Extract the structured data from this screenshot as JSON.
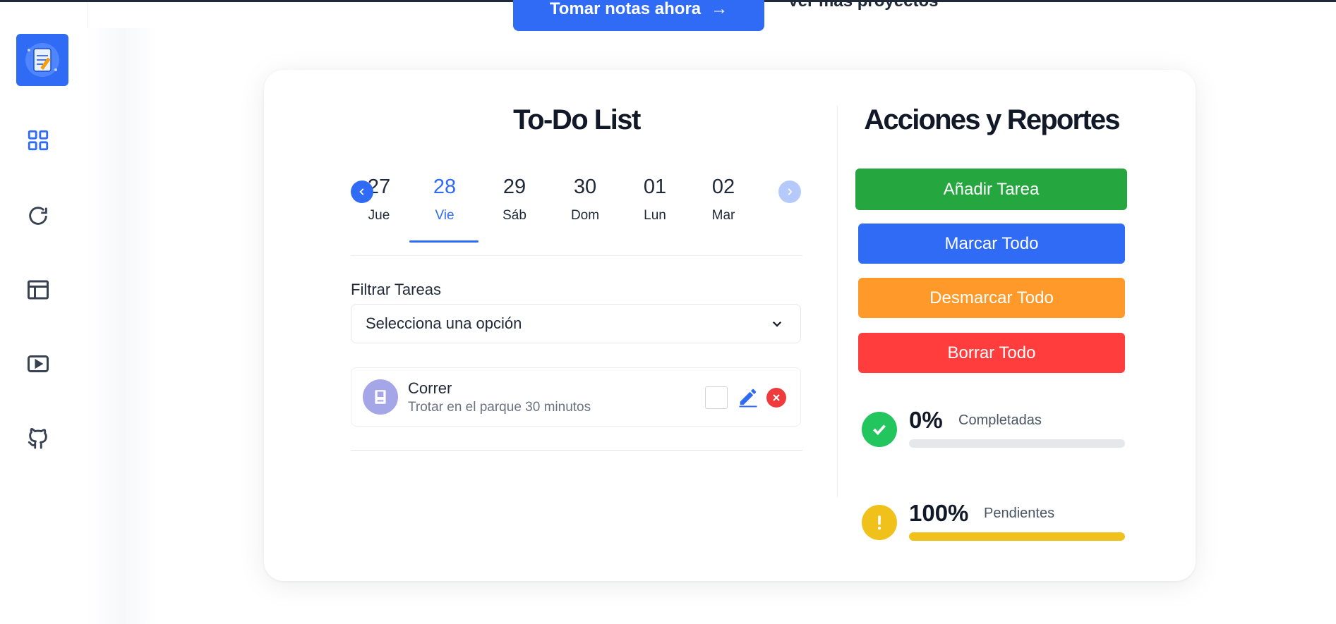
{
  "header": {
    "cta_label": "Tomar notas ahora",
    "cta_arrow": "→",
    "more_projects_label": "Ver más proyectos"
  },
  "sidebar": {
    "items": [
      {
        "icon": "dashboard-icon"
      },
      {
        "icon": "refresh-icon"
      },
      {
        "icon": "browser-window-icon"
      },
      {
        "icon": "video-play-icon"
      },
      {
        "icon": "github-icon"
      }
    ],
    "accent": "#2f6bf5"
  },
  "todo": {
    "title": "To-Do List",
    "days": [
      {
        "num": "27",
        "name": "Jue"
      },
      {
        "num": "28",
        "name": "Vie",
        "active": true
      },
      {
        "num": "29",
        "name": "Sáb"
      },
      {
        "num": "30",
        "name": "Dom"
      },
      {
        "num": "01",
        "name": "Lun"
      },
      {
        "num": "02",
        "name": "Mar"
      }
    ],
    "filter_label": "Filtrar Tareas",
    "filter_selected": "Selecciona una opción",
    "tasks": [
      {
        "title": "Correr",
        "description": "Trotar en el parque 30 minutos",
        "done": false
      }
    ]
  },
  "actions": {
    "title": "Acciones y Reportes",
    "buttons": [
      {
        "label": "Añadir Tarea",
        "color": "#25a63f"
      },
      {
        "label": "Marcar Todo",
        "color": "#2f6bf5"
      },
      {
        "label": "Desmarcar Todo",
        "color": "#ff9a2a"
      },
      {
        "label": "Borrar Todo",
        "color": "#ff3d3d"
      }
    ],
    "stats": [
      {
        "percent_label": "0%",
        "label": "Completadas",
        "progress": 0,
        "color": "#22c55e"
      },
      {
        "percent_label": "100%",
        "label": "Pendientes",
        "progress": 100,
        "color": "#f0c11b"
      }
    ]
  }
}
